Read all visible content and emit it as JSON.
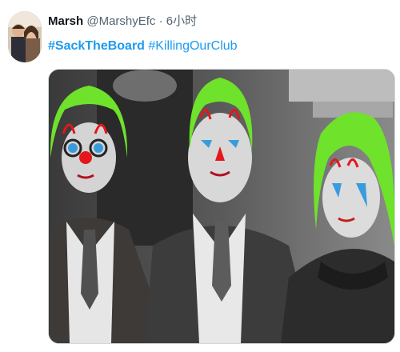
{
  "tweet": {
    "display_name": "Marsh",
    "handle": "@MarshyEfc",
    "separator": "·",
    "time": "6小时",
    "hashtags": [
      {
        "text": "#SackTheBoard"
      },
      {
        "text": "#KillingOurClub"
      }
    ]
  },
  "media": {
    "description_icon": "photo-image"
  },
  "colors": {
    "link": "#1d9bf0",
    "text": "#0f1419",
    "secondary": "#536471",
    "hair_green": "#6fe22b",
    "clown_red": "#e3171c",
    "eye_blue": "#3a9bdc"
  }
}
